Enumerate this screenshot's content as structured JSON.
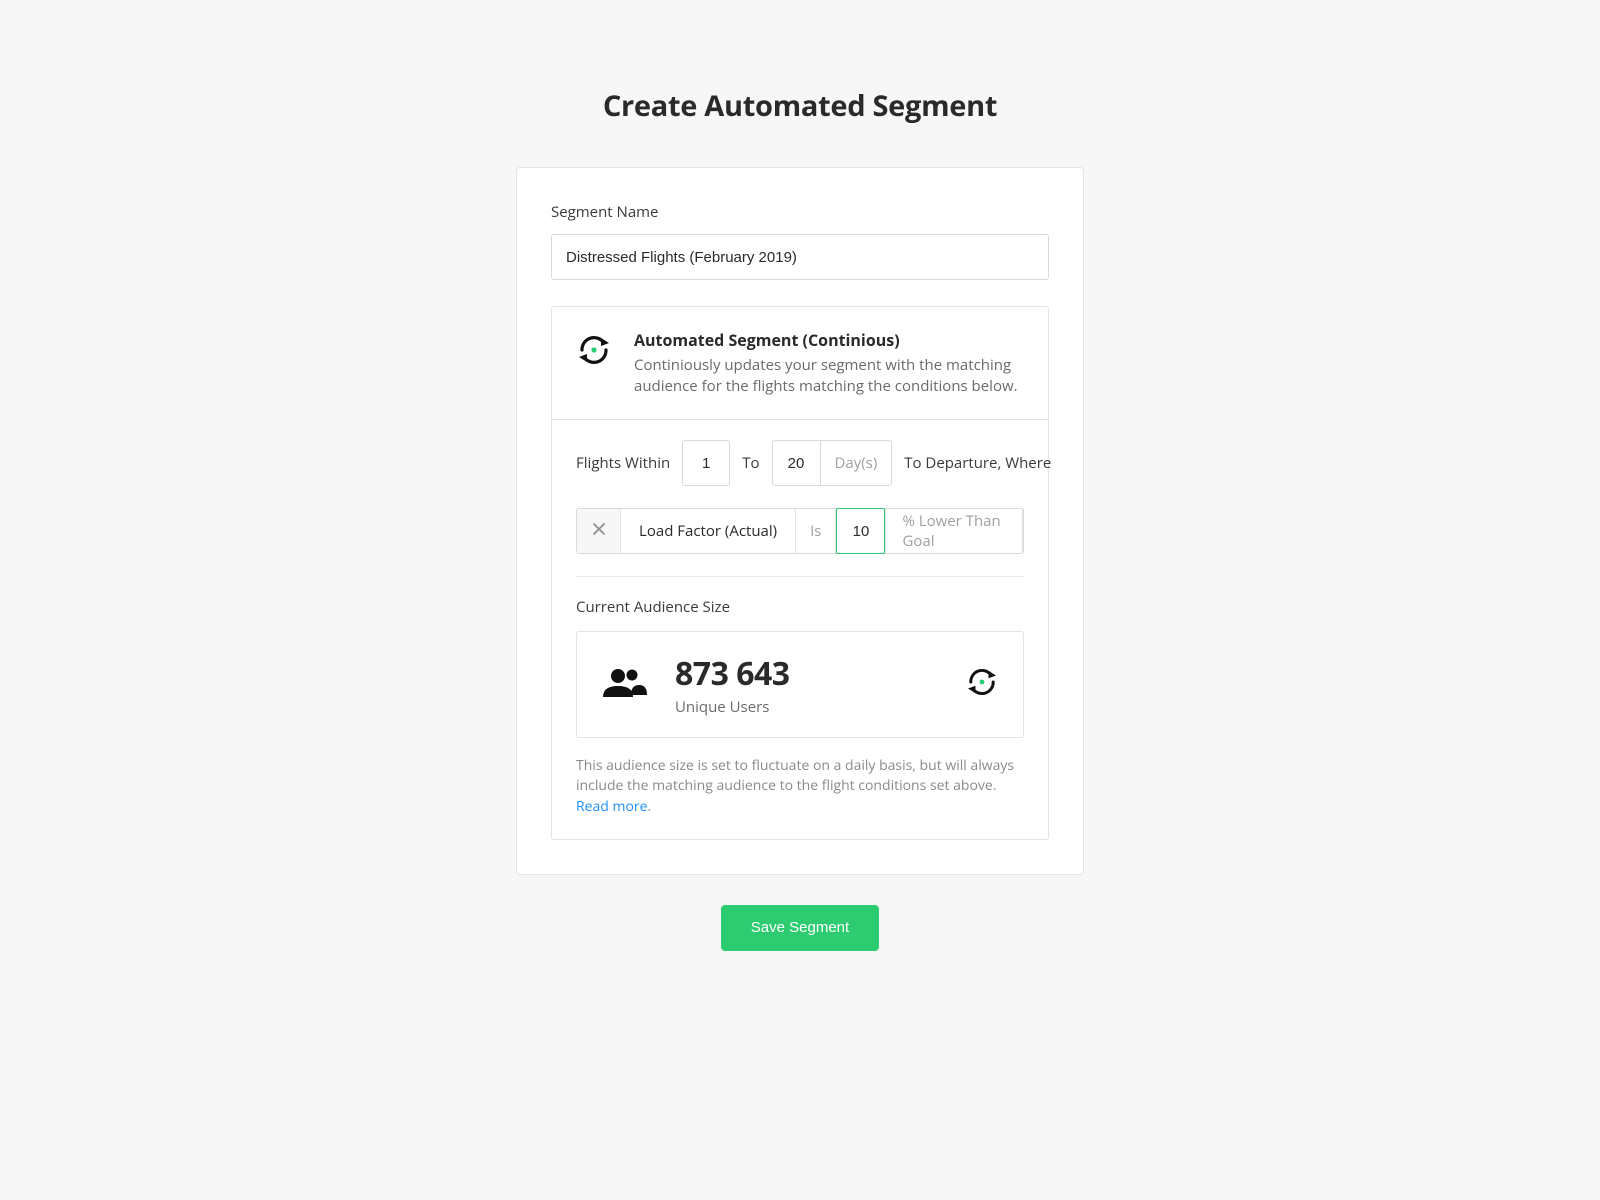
{
  "page": {
    "title": "Create Automated Segment"
  },
  "segment_name": {
    "label": "Segment Name",
    "value": "Distressed Flights (February 2019)"
  },
  "info": {
    "title": "Automated Segment (Continious)",
    "description": "Continiously updates your segment with the matching audience for the flights matching the conditions below."
  },
  "conditions": {
    "within_label": "Flights Within",
    "from_value": "1",
    "to_label": "To",
    "to_value": "20",
    "unit": "Day(s)",
    "suffix_label": "To Departure, Where",
    "filter": {
      "metric": "Load Factor (Actual)",
      "is_label": "Is",
      "value": "10",
      "comparison": "% Lower Than Goal"
    }
  },
  "audience": {
    "label": "Current Audience Size",
    "count": "873 643",
    "sublabel": "Unique Users",
    "note_prefix": "This audience size is set to fluctuate on a daily basis, but will always include the matching audience to the flight conditions set above. ",
    "note_link": "Read more",
    "note_suffix": "."
  },
  "actions": {
    "save": "Save Segment"
  }
}
